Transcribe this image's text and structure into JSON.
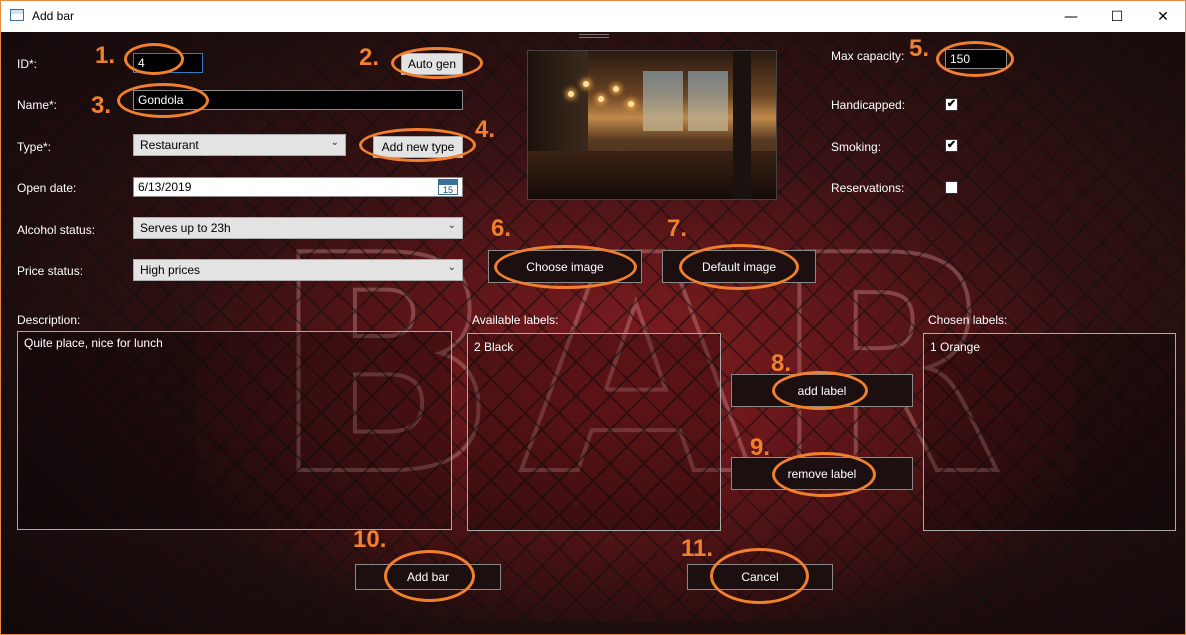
{
  "window": {
    "title": "Add bar",
    "minimize": "—",
    "maximize": "☐",
    "close": "✕"
  },
  "form": {
    "id_label": "ID*:",
    "id_value": "4",
    "name_label": "Name*:",
    "name_value": "Gondola",
    "type_label": "Type*:",
    "type_value": "Restaurant",
    "open_date_label": "Open date:",
    "open_date_value": "6/13/2019",
    "calendar_day": "15",
    "alcohol_label": "Alcohol status:",
    "alcohol_value": "Serves up to 23h",
    "price_label": "Price status:",
    "price_value": "High prices",
    "description_label": "Description:",
    "description_value": "Quite place, nice for lunch",
    "max_capacity_label": "Max capacity:",
    "max_capacity_value": "150",
    "handicapped_label": "Handicapped:",
    "handicapped_checked": true,
    "smoking_label": "Smoking:",
    "smoking_checked": true,
    "reservations_label": "Reservations:",
    "reservations_checked": false,
    "available_labels_title": "Available labels:",
    "available_labels": [
      "2 Black"
    ],
    "chosen_labels_title": "Chosen labels:",
    "chosen_labels": [
      "1 Orange"
    ]
  },
  "buttons": {
    "auto_gen": "Auto gen",
    "add_new_type": "Add new type",
    "choose_image": "Choose image",
    "default_image": "Default image",
    "add_label": "add label",
    "remove_label": "remove label",
    "add_bar": "Add bar",
    "cancel": "Cancel"
  },
  "annotations": {
    "n1": "1.",
    "n2": "2.",
    "n3": "3.",
    "n4": "4.",
    "n5": "5.",
    "n6": "6.",
    "n7": "7.",
    "n8": "8.",
    "n9": "9.",
    "n10": "10.",
    "n11": "11.",
    "color": "#f07f2e"
  },
  "check_glyph": "✔",
  "dropdown_glyph": "⌄"
}
